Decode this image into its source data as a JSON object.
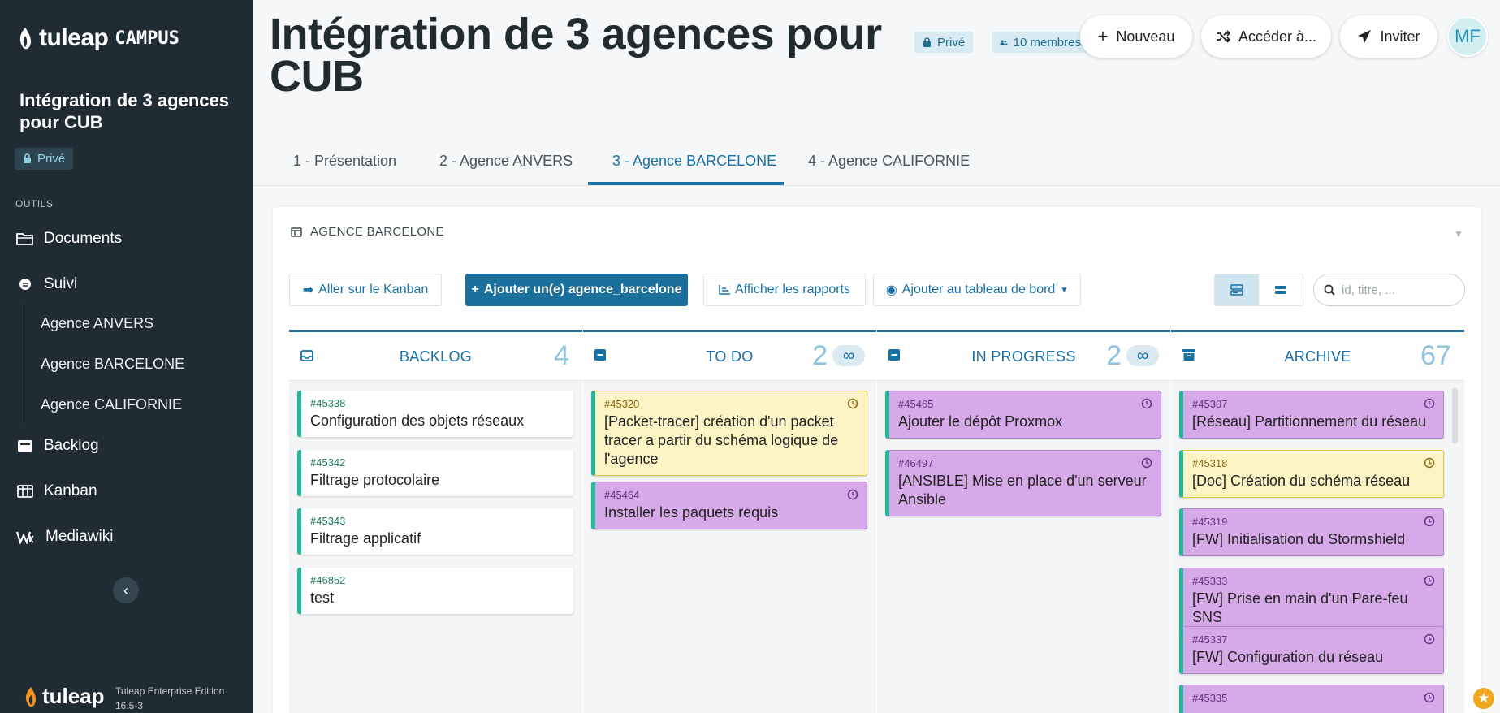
{
  "sidebar": {
    "logo_text": "tuleap",
    "logo_campus": "CAMPUS",
    "project_title": "Intégration de 3 agences pour CUB",
    "privacy_badge": "Privé",
    "section_label": "OUTILS",
    "items": [
      {
        "label": "Documents",
        "icon": "folder-icon"
      },
      {
        "label": "Suivi",
        "icon": "tracker-icon"
      },
      {
        "label": "Backlog",
        "icon": "backlog-icon"
      },
      {
        "label": "Kanban",
        "icon": "kanban-icon"
      },
      {
        "label": "Mediawiki",
        "icon": "mediawiki-icon"
      }
    ],
    "subitems": [
      "Agence ANVERS",
      "Agence BARCELONE",
      "Agence CALIFORNIE"
    ],
    "footer_logo": "tuleap",
    "edition": "Tuleap Enterprise Edition",
    "version": "16.5-3"
  },
  "header": {
    "title": "Intégration de 3 agences pour CUB",
    "privacy": "Privé",
    "members": "10 membres",
    "buttons": {
      "new": "Nouveau",
      "goto": "Accéder à...",
      "invite": "Inviter"
    },
    "avatar_initials": "MF"
  },
  "tabs": [
    {
      "label": "1 - Présentation",
      "active": false
    },
    {
      "label": "2 - Agence ANVERS",
      "active": false
    },
    {
      "label": "3 - Agence BARCELONE",
      "active": true
    },
    {
      "label": "4 - Agence CALIFORNIE",
      "active": false
    }
  ],
  "widget": {
    "title": "AGENCE BARCELONE",
    "buttons": {
      "kanban": "Aller sur le Kanban",
      "add": "Ajouter un(e) agence_barcelone",
      "reports": "Afficher les rapports",
      "dashboard": "Ajouter au tableau de bord"
    },
    "search_placeholder": "id, titre, ..."
  },
  "columns": [
    {
      "label": "BACKLOG",
      "count": "4",
      "limit": "",
      "cards": [
        {
          "id": "#45338",
          "title": "Configuration des objets réseaux",
          "style": "white"
        },
        {
          "id": "#45342",
          "title": "Filtrage protocolaire",
          "style": "white"
        },
        {
          "id": "#45343",
          "title": "Filtrage applicatif",
          "style": "white"
        },
        {
          "id": "#46852",
          "title": "test",
          "style": "white"
        }
      ]
    },
    {
      "label": "TO DO",
      "count": "2",
      "limit": "∞",
      "cards": [
        {
          "id": "#45320",
          "title": "[Packet-tracer] création d'un packet tracer a partir du schéma logique de l'agence",
          "style": "yellow"
        },
        {
          "id": "#45464",
          "title": "Installer les paquets requis",
          "style": "purple"
        }
      ]
    },
    {
      "label": "IN PROGRESS",
      "count": "2",
      "limit": "∞",
      "cards": [
        {
          "id": "#45465",
          "title": "Ajouter le dépôt Proxmox",
          "style": "purple"
        },
        {
          "id": "#46497",
          "title": "[ANSIBLE] Mise en place d'un serveur Ansible",
          "style": "purple"
        }
      ]
    },
    {
      "label": "ARCHIVE",
      "count": "67",
      "limit": "",
      "cards": [
        {
          "id": "#45307",
          "title": "[Réseau] Partitionnement du réseau",
          "style": "purple"
        },
        {
          "id": "#45318",
          "title": "[Doc] Création du schéma réseau",
          "style": "yellow"
        },
        {
          "id": "#45319",
          "title": "[FW] Initialisation du Stormshield",
          "style": "purple"
        },
        {
          "id": "#45333",
          "title": "[FW] Prise en main d'un Pare-feu SNS",
          "style": "purple"
        },
        {
          "id": "#45337",
          "title": "[FW] Configuration du réseau",
          "style": "purple"
        },
        {
          "id": "#45335",
          "title": "",
          "style": "purple"
        }
      ]
    }
  ],
  "colors": {
    "sidebar_bg": "#1f2c33",
    "accent": "#1771a6",
    "primary_button": "#1a6f9c",
    "card_stripe": "#21b89a",
    "card_yellow": "#fdf4c5",
    "card_purple": "#d6a9e8"
  }
}
